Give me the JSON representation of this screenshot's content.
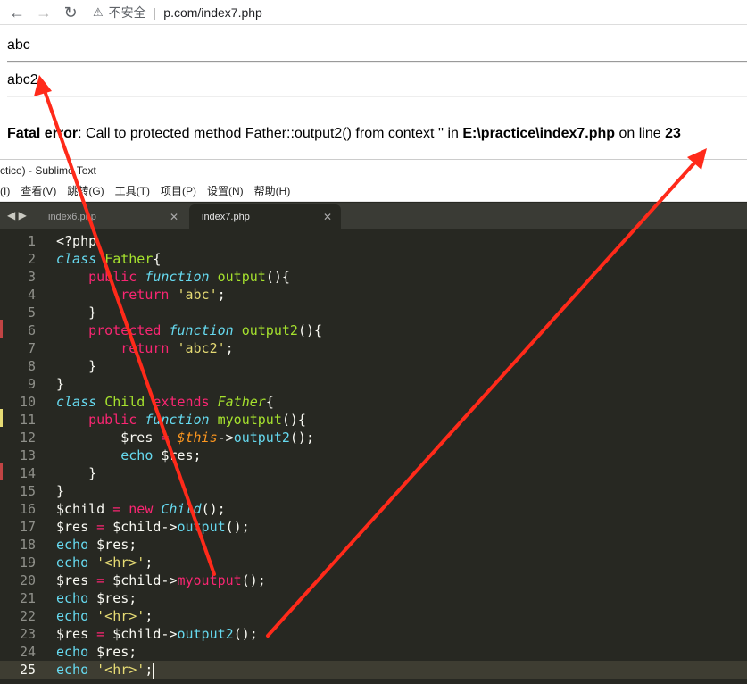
{
  "browser": {
    "back_icon": "arrow-left-icon",
    "forward_icon": "arrow-right-icon",
    "reload_icon": "reload-icon",
    "security_text": "不安全",
    "url": "p.com/index7.php"
  },
  "page": {
    "output1": "abc",
    "output2": "abc2",
    "fatal_label": "Fatal error",
    "fatal_msg": ": Call to protected method Father::output2() from context '' in ",
    "fatal_file": "E:\\practice\\index7.php",
    "fatal_on": " on line ",
    "fatal_line": "23"
  },
  "sublime": {
    "window_title": "ctice) - Sublime Text",
    "menu": [
      "(I)",
      "查看(V)",
      "跳转(G)",
      "工具(T)",
      "项目(P)",
      "设置(N)",
      "帮助(H)"
    ],
    "tabs": [
      {
        "label": "index6.php",
        "active": false
      },
      {
        "label": "index7.php",
        "active": true
      }
    ],
    "line_numbers": [
      "1",
      "2",
      "3",
      "4",
      "5",
      "6",
      "7",
      "8",
      "9",
      "10",
      "11",
      "12",
      "13",
      "14",
      "15",
      "16",
      "17",
      "18",
      "19",
      "20",
      "21",
      "22",
      "23",
      "24",
      "25"
    ]
  },
  "colors": {
    "editor_bg": "#272822",
    "arrow": "#ff2a1a"
  }
}
